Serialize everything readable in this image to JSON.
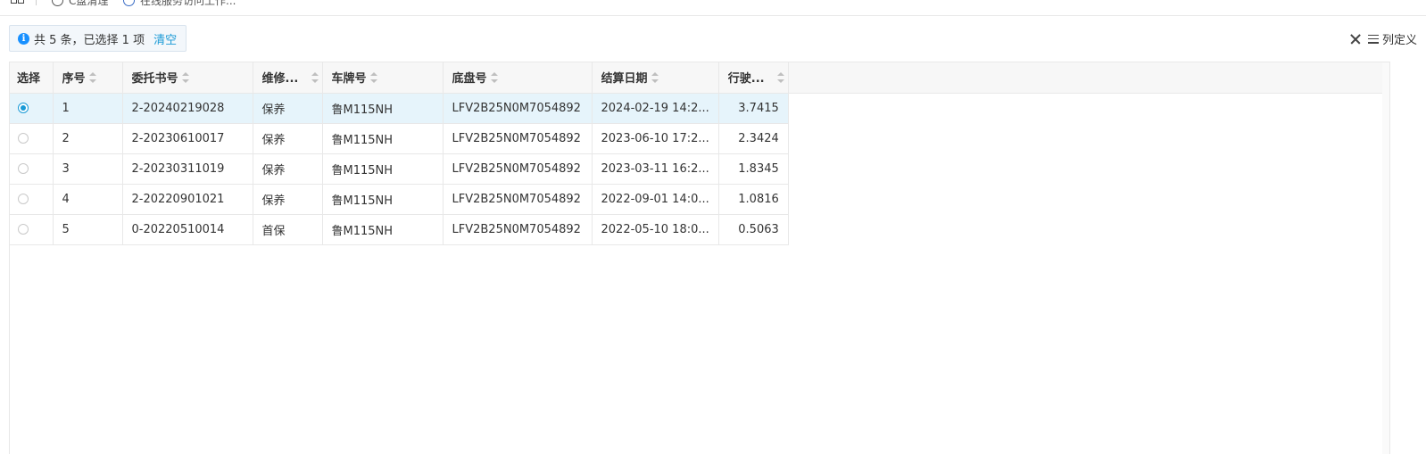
{
  "topbar": {
    "tab1_label": "C盘清理",
    "tab2_label": "在线服务访问工作..."
  },
  "info": {
    "summary": "共 5 条，已选择 1 项",
    "clear_label": "清空"
  },
  "toolbar": {
    "column_def_label": "列定义"
  },
  "table": {
    "headers": {
      "select": "选择",
      "index": "序号",
      "order_no": "委托书号",
      "repair_type": "维修...",
      "plate": "车牌号",
      "vin": "底盘号",
      "settle_date": "结算日期",
      "mileage": "行驶..."
    },
    "rows": [
      {
        "selected": true,
        "index": "1",
        "order_no": "2-20240219028",
        "repair_type": "保养",
        "plate": "鲁M115NH",
        "vin": "LFV2B25N0M7054892",
        "settle_date": "2024-02-19 14:2...",
        "mileage": "3.7415"
      },
      {
        "selected": false,
        "index": "2",
        "order_no": "2-20230610017",
        "repair_type": "保养",
        "plate": "鲁M115NH",
        "vin": "LFV2B25N0M7054892",
        "settle_date": "2023-06-10 17:2...",
        "mileage": "2.3424"
      },
      {
        "selected": false,
        "index": "3",
        "order_no": "2-20230311019",
        "repair_type": "保养",
        "plate": "鲁M115NH",
        "vin": "LFV2B25N0M7054892",
        "settle_date": "2023-03-11 16:2...",
        "mileage": "1.8345"
      },
      {
        "selected": false,
        "index": "4",
        "order_no": "2-20220901021",
        "repair_type": "保养",
        "plate": "鲁M115NH",
        "vin": "LFV2B25N0M7054892",
        "settle_date": "2022-09-01 14:0...",
        "mileage": "1.0816"
      },
      {
        "selected": false,
        "index": "5",
        "order_no": "0-20220510014",
        "repair_type": "首保",
        "plate": "鲁M115NH",
        "vin": "LFV2B25N0M7054892",
        "settle_date": "2022-05-10 18:0...",
        "mileage": "0.5063"
      }
    ]
  },
  "colors": {
    "accent": "#1a9ad6",
    "selected_row_bg": "#e6f4fb",
    "info_icon": "#1890ff"
  }
}
